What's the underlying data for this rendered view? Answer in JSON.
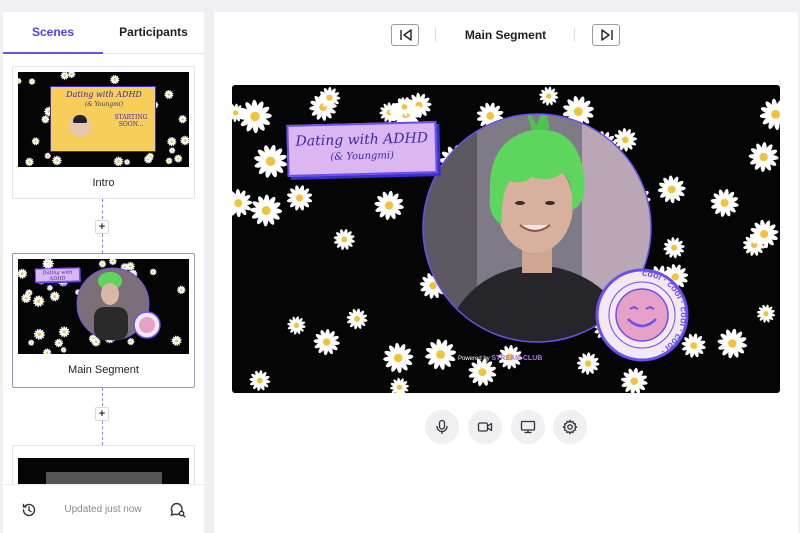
{
  "sidebar": {
    "tabs": [
      {
        "label": "Scenes",
        "active": true
      },
      {
        "label": "Participants",
        "active": false
      }
    ],
    "scenes": [
      {
        "name": "Intro",
        "thumb_title": "Dating with ADHD",
        "thumb_subtitle": "(& Youngmi)",
        "thumb_status": "STARTING SOON..."
      },
      {
        "name": "Main Segment",
        "active": true
      },
      {
        "name": ""
      }
    ],
    "add_label": "+",
    "footer": {
      "updated_text": "Updated just now",
      "history_icon": "history-icon",
      "chat_icon": "chat-search-icon"
    }
  },
  "main": {
    "segment_title": "Main Segment",
    "prev_icon": "skip-previous-icon",
    "next_icon": "skip-next-icon"
  },
  "stage": {
    "banner_title": "Dating with ADHD",
    "banner_subtitle": "(& Youngmi)",
    "powered_by": "Powered by",
    "brand": "STREAM CLUB",
    "badge_text": "cool · cool · cool · cool ·"
  },
  "controls": [
    {
      "name": "microphone",
      "icon": "microphone-icon"
    },
    {
      "name": "camera",
      "icon": "camera-icon"
    },
    {
      "name": "screen-share",
      "icon": "monitor-icon"
    },
    {
      "name": "settings",
      "icon": "gear-icon"
    }
  ],
  "colors": {
    "accent": "#6b4ff0",
    "banner": "#dcb6f0",
    "badge_ring": "#6b4ff0",
    "badge_face": "#e7a1c6",
    "hair": "#5ed65e"
  }
}
